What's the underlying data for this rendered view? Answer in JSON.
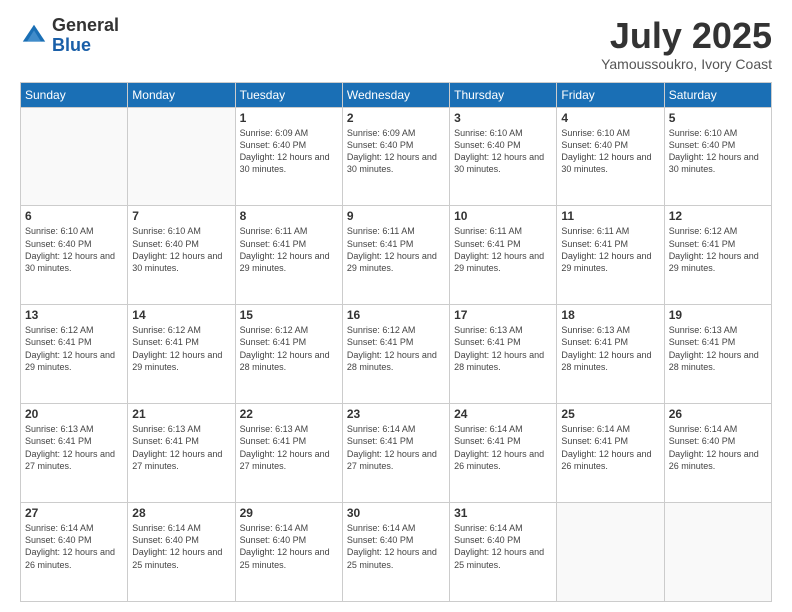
{
  "logo": {
    "general": "General",
    "blue": "Blue"
  },
  "title": "July 2025",
  "subtitle": "Yamoussoukro, Ivory Coast",
  "days_of_week": [
    "Sunday",
    "Monday",
    "Tuesday",
    "Wednesday",
    "Thursday",
    "Friday",
    "Saturday"
  ],
  "weeks": [
    [
      {
        "day": "",
        "detail": ""
      },
      {
        "day": "",
        "detail": ""
      },
      {
        "day": "1",
        "detail": "Sunrise: 6:09 AM\nSunset: 6:40 PM\nDaylight: 12 hours and 30 minutes."
      },
      {
        "day": "2",
        "detail": "Sunrise: 6:09 AM\nSunset: 6:40 PM\nDaylight: 12 hours and 30 minutes."
      },
      {
        "day": "3",
        "detail": "Sunrise: 6:10 AM\nSunset: 6:40 PM\nDaylight: 12 hours and 30 minutes."
      },
      {
        "day": "4",
        "detail": "Sunrise: 6:10 AM\nSunset: 6:40 PM\nDaylight: 12 hours and 30 minutes."
      },
      {
        "day": "5",
        "detail": "Sunrise: 6:10 AM\nSunset: 6:40 PM\nDaylight: 12 hours and 30 minutes."
      }
    ],
    [
      {
        "day": "6",
        "detail": "Sunrise: 6:10 AM\nSunset: 6:40 PM\nDaylight: 12 hours and 30 minutes."
      },
      {
        "day": "7",
        "detail": "Sunrise: 6:10 AM\nSunset: 6:40 PM\nDaylight: 12 hours and 30 minutes."
      },
      {
        "day": "8",
        "detail": "Sunrise: 6:11 AM\nSunset: 6:41 PM\nDaylight: 12 hours and 29 minutes."
      },
      {
        "day": "9",
        "detail": "Sunrise: 6:11 AM\nSunset: 6:41 PM\nDaylight: 12 hours and 29 minutes."
      },
      {
        "day": "10",
        "detail": "Sunrise: 6:11 AM\nSunset: 6:41 PM\nDaylight: 12 hours and 29 minutes."
      },
      {
        "day": "11",
        "detail": "Sunrise: 6:11 AM\nSunset: 6:41 PM\nDaylight: 12 hours and 29 minutes."
      },
      {
        "day": "12",
        "detail": "Sunrise: 6:12 AM\nSunset: 6:41 PM\nDaylight: 12 hours and 29 minutes."
      }
    ],
    [
      {
        "day": "13",
        "detail": "Sunrise: 6:12 AM\nSunset: 6:41 PM\nDaylight: 12 hours and 29 minutes."
      },
      {
        "day": "14",
        "detail": "Sunrise: 6:12 AM\nSunset: 6:41 PM\nDaylight: 12 hours and 29 minutes."
      },
      {
        "day": "15",
        "detail": "Sunrise: 6:12 AM\nSunset: 6:41 PM\nDaylight: 12 hours and 28 minutes."
      },
      {
        "day": "16",
        "detail": "Sunrise: 6:12 AM\nSunset: 6:41 PM\nDaylight: 12 hours and 28 minutes."
      },
      {
        "day": "17",
        "detail": "Sunrise: 6:13 AM\nSunset: 6:41 PM\nDaylight: 12 hours and 28 minutes."
      },
      {
        "day": "18",
        "detail": "Sunrise: 6:13 AM\nSunset: 6:41 PM\nDaylight: 12 hours and 28 minutes."
      },
      {
        "day": "19",
        "detail": "Sunrise: 6:13 AM\nSunset: 6:41 PM\nDaylight: 12 hours and 28 minutes."
      }
    ],
    [
      {
        "day": "20",
        "detail": "Sunrise: 6:13 AM\nSunset: 6:41 PM\nDaylight: 12 hours and 27 minutes."
      },
      {
        "day": "21",
        "detail": "Sunrise: 6:13 AM\nSunset: 6:41 PM\nDaylight: 12 hours and 27 minutes."
      },
      {
        "day": "22",
        "detail": "Sunrise: 6:13 AM\nSunset: 6:41 PM\nDaylight: 12 hours and 27 minutes."
      },
      {
        "day": "23",
        "detail": "Sunrise: 6:14 AM\nSunset: 6:41 PM\nDaylight: 12 hours and 27 minutes."
      },
      {
        "day": "24",
        "detail": "Sunrise: 6:14 AM\nSunset: 6:41 PM\nDaylight: 12 hours and 26 minutes."
      },
      {
        "day": "25",
        "detail": "Sunrise: 6:14 AM\nSunset: 6:41 PM\nDaylight: 12 hours and 26 minutes."
      },
      {
        "day": "26",
        "detail": "Sunrise: 6:14 AM\nSunset: 6:40 PM\nDaylight: 12 hours and 26 minutes."
      }
    ],
    [
      {
        "day": "27",
        "detail": "Sunrise: 6:14 AM\nSunset: 6:40 PM\nDaylight: 12 hours and 26 minutes."
      },
      {
        "day": "28",
        "detail": "Sunrise: 6:14 AM\nSunset: 6:40 PM\nDaylight: 12 hours and 25 minutes."
      },
      {
        "day": "29",
        "detail": "Sunrise: 6:14 AM\nSunset: 6:40 PM\nDaylight: 12 hours and 25 minutes."
      },
      {
        "day": "30",
        "detail": "Sunrise: 6:14 AM\nSunset: 6:40 PM\nDaylight: 12 hours and 25 minutes."
      },
      {
        "day": "31",
        "detail": "Sunrise: 6:14 AM\nSunset: 6:40 PM\nDaylight: 12 hours and 25 minutes."
      },
      {
        "day": "",
        "detail": ""
      },
      {
        "day": "",
        "detail": ""
      }
    ]
  ]
}
